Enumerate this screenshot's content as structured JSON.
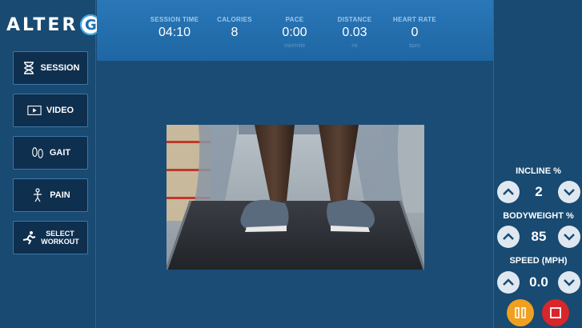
{
  "brand": {
    "logo_text": "ALTER",
    "logo_letter": "G"
  },
  "sidebar": {
    "items": [
      {
        "label": "SESSION",
        "icon": "hourglass-icon"
      },
      {
        "label": "VIDEO",
        "icon": "video-icon"
      },
      {
        "label": "GAIT",
        "icon": "footprints-icon"
      },
      {
        "label": "PAIN",
        "icon": "body-icon"
      },
      {
        "label_line1": "SELECT",
        "label_line2": "WORKOUT",
        "icon": "runner-icon"
      }
    ]
  },
  "stats": [
    {
      "label": "SESSION TIME",
      "value": "04:10",
      "unit": ""
    },
    {
      "label": "CALORIES",
      "value": "8",
      "unit": ""
    },
    {
      "label": "PACE",
      "value": "0:00",
      "unit": "min/mile"
    },
    {
      "label": "DISTANCE",
      "value": "0.03",
      "unit": "mi"
    },
    {
      "label": "HEART RATE",
      "value": "0",
      "unit": "bpm"
    }
  ],
  "controls": {
    "incline": {
      "label": "INCLINE %",
      "value": "2"
    },
    "bodyweight": {
      "label": "BODYWEIGHT %",
      "value": "85"
    },
    "speed": {
      "label": "SPEED (MPH)",
      "value": "0.0"
    }
  },
  "actions": {
    "pause_icon": "pause-icon",
    "stop_icon": "stop-icon"
  },
  "colors": {
    "background": "#1b4a73",
    "topbar": "#2a77b8",
    "pause": "#f0a020",
    "stop": "#d8262a"
  }
}
